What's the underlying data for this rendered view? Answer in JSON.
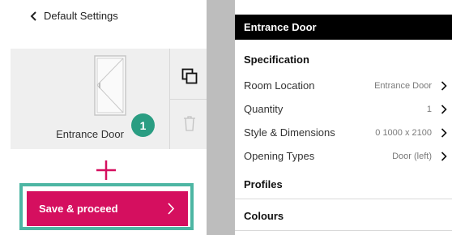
{
  "left": {
    "back_label": "Default Settings",
    "item": {
      "label": "Entrance Door",
      "count": "1"
    },
    "save_label": "Save & proceed"
  },
  "right": {
    "header": "Entrance Door",
    "sections": {
      "specification": "Specification",
      "profiles": "Profiles",
      "colours": "Colours"
    },
    "rows": [
      {
        "label": "Room Location",
        "value": "Entrance Door"
      },
      {
        "label": "Quantity",
        "value": "1"
      },
      {
        "label": "Style & Dimensions",
        "value": "0 1000 x 2100"
      },
      {
        "label": "Opening Types",
        "value": "Door (left)"
      }
    ]
  },
  "colors": {
    "accent": "#d50f5f",
    "highlight": "#4db6a3",
    "badge": "#2a9d82",
    "header": "#000000"
  },
  "icons": [
    "chevron-left-icon",
    "door-icon",
    "copy-icon",
    "trash-icon",
    "plus-icon",
    "chevron-right-icon"
  ]
}
